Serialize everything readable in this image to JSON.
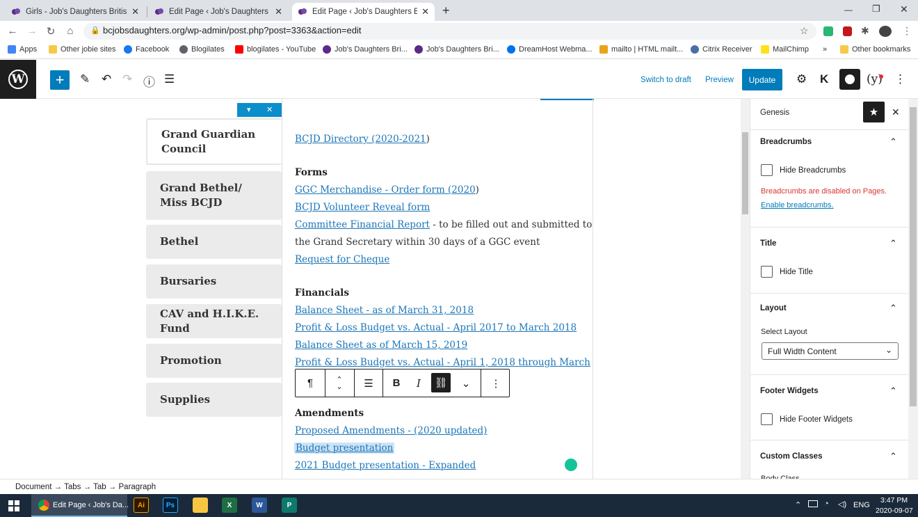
{
  "browser": {
    "tabs": [
      {
        "title": "Girls - Job's Daughters British Co",
        "active": false
      },
      {
        "title": "Edit Page ‹ Job's Daughters Britis",
        "active": false
      },
      {
        "title": "Edit Page ‹ Job's Daughters Britis",
        "active": true
      }
    ],
    "new_tab": "+",
    "url": "bcjobsdaughters.org/wp-admin/post.php?post=3363&action=edit",
    "window_controls": {
      "minimize": "—",
      "restore": "❐",
      "close": "✕"
    },
    "bookmarks": [
      {
        "label": "Apps",
        "icon": "apps-grid-icon",
        "color": "#4285f4"
      },
      {
        "label": "Other jobie sites",
        "icon": "folder-icon",
        "color": "#f7c948"
      },
      {
        "label": "Facebook",
        "icon": "facebook-icon",
        "color": "#1877f2"
      },
      {
        "label": "Blogilates",
        "icon": "globe-icon",
        "color": "#5f6368"
      },
      {
        "label": "blogilates - YouTube",
        "icon": "youtube-icon",
        "color": "#ff0000"
      },
      {
        "label": "Job's Daughters Bri...",
        "icon": "jd-icon",
        "color": "#5b2a86"
      },
      {
        "label": "Job's Daughters Bri...",
        "icon": "jd-icon",
        "color": "#5b2a86"
      },
      {
        "label": "DreamHost Webma...",
        "icon": "dreamhost-icon",
        "color": "#0073ec"
      },
      {
        "label": "mailto | HTML mailt...",
        "icon": "r-icon",
        "color": "#e8a317"
      },
      {
        "label": "Citrix Receiver",
        "icon": "citrix-icon",
        "color": "#4a6fa5"
      },
      {
        "label": "MailChimp",
        "icon": "mailchimp-icon",
        "color": "#ffe01b"
      },
      {
        "label": "»",
        "icon": "",
        "color": ""
      },
      {
        "label": "Other bookmarks",
        "icon": "folder-icon",
        "color": "#f7c948"
      }
    ]
  },
  "wp": {
    "toolbar": {
      "switch_to_draft": "Switch to draft",
      "preview": "Preview",
      "update": "Update"
    },
    "tabs": [
      {
        "label": "Grand Guardian Council"
      },
      {
        "label": "Grand Bethel/ Miss BCJD"
      },
      {
        "label": "Bethel"
      },
      {
        "label": "Bursaries"
      },
      {
        "label": "CAV and H.I.K.E. Fund"
      },
      {
        "label": "Promotion"
      },
      {
        "label": "Supplies"
      }
    ],
    "content": {
      "directory": "BCJD Directory (2020-2021",
      "directory_close": ")",
      "forms_heading": "Forms",
      "ggc_merch": "GGC Merchandise - Order form (2020",
      "ggc_merch_close": ")",
      "volunteer": "BCJD Volunteer Reveal form",
      "committee": "Committee Financial Report",
      "committee_rest": " - to be filled out and submitted to",
      "committee_line2": "the Grand Secretary within 30 days of a GGC event",
      "cheque": "Request for Cheque",
      "financials_heading": "Financials",
      "bs2018": "Balance Sheet - as of March 31, 2018",
      "pl2018": "Profit & Loss Budget vs. Actual - April 2017 to March 2018",
      "bs2019": "Balance Sheet as of March 15, 2019",
      "pl2019": "Profit & Loss Budget vs. Actual - April 1, 2018 through March",
      "amendments_heading": "Amendments",
      "proposed": "Proposed Amendments - (2020 updated)",
      "budget": "Budget presentation",
      "budget2021": "2021 Budget presentation - Expanded"
    },
    "sidebar": {
      "title": "Genesis",
      "breadcrumbs_heading": "Breadcrumbs",
      "hide_breadcrumbs": "Hide Breadcrumbs",
      "breadcrumbs_note": "Breadcrumbs are disabled on Pages.",
      "enable_breadcrumbs": "Enable breadcrumbs.",
      "title_heading": "Title",
      "hide_title": "Hide Title",
      "layout_heading": "Layout",
      "select_layout": "Select Layout",
      "layout_value": "Full Width Content",
      "footer_heading": "Footer Widgets",
      "hide_footer": "Hide Footer Widgets",
      "custom_heading": "Custom Classes",
      "body_class": "Body Class"
    },
    "breadcrumb": "Document  →  Tabs  →  Tab  →  Paragraph"
  },
  "taskbar": {
    "active_app": "Edit Page ‹ Job's Da...",
    "lang": "ENG",
    "time": "3:47 PM",
    "date": "2020-09-07"
  }
}
